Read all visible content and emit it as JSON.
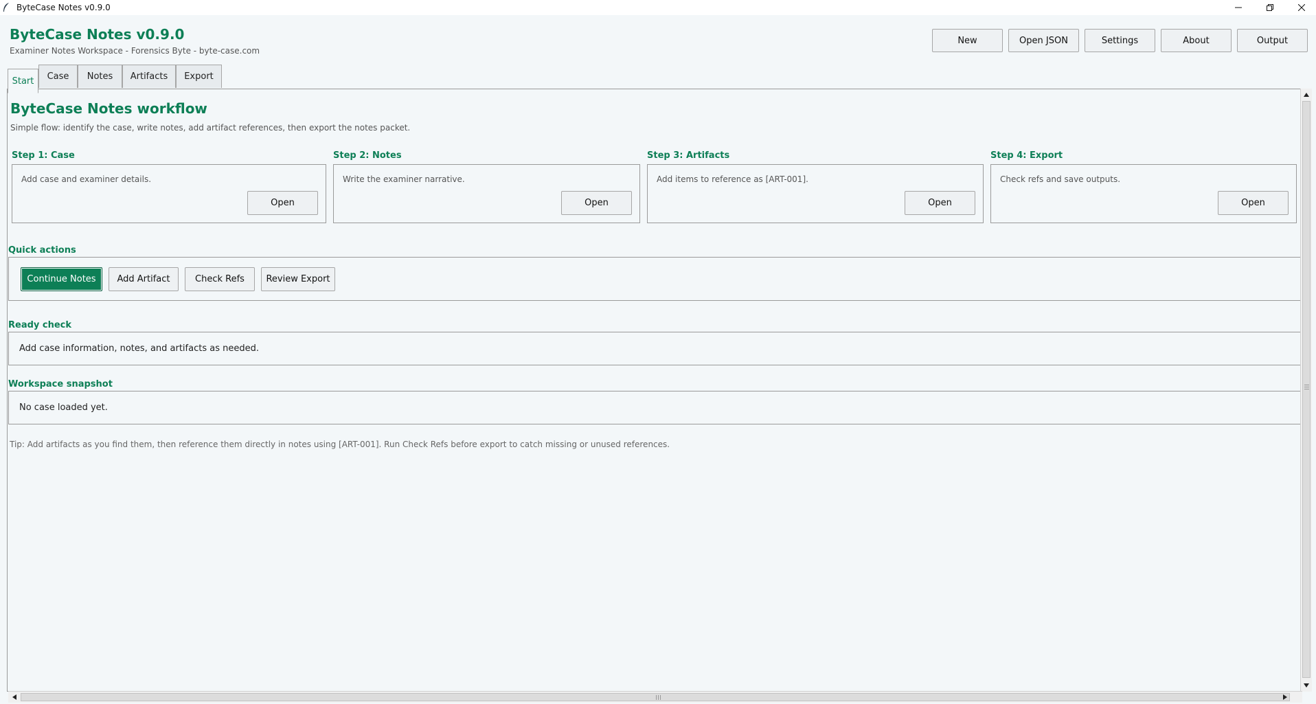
{
  "window": {
    "title": "ByteCase Notes v0.9.0",
    "icon": "feather-icon",
    "controls": [
      "minimize-icon",
      "restore-icon",
      "close-icon"
    ]
  },
  "header": {
    "title": "ByteCase Notes v0.9.0",
    "subtitle": "Examiner Notes Workspace - Forensics Byte - byte-case.com",
    "buttons": [
      "New",
      "Open JSON",
      "Settings",
      "About",
      "Output"
    ]
  },
  "tabs": [
    {
      "label": "Start",
      "active": true
    },
    {
      "label": "Case",
      "active": false
    },
    {
      "label": "Notes",
      "active": false
    },
    {
      "label": "Artifacts",
      "active": false
    },
    {
      "label": "Export",
      "active": false
    }
  ],
  "start": {
    "title": "ByteCase Notes workflow",
    "description": "Simple flow: identify the case, write notes, add artifact references, then export the notes packet.",
    "steps": [
      {
        "label": "Step 1: Case",
        "text": "Add case and examiner details.",
        "button": "Open"
      },
      {
        "label": "Step 2: Notes",
        "text": "Write the examiner narrative.",
        "button": "Open"
      },
      {
        "label": "Step 3: Artifacts",
        "text": "Add items to reference as [ART-001].",
        "button": "Open"
      },
      {
        "label": "Step 4: Export",
        "text": "Check refs and save outputs.",
        "button": "Open"
      }
    ],
    "quick_actions": {
      "label": "Quick actions",
      "buttons": [
        "Continue Notes",
        "Add Artifact",
        "Check Refs",
        "Review Export"
      ]
    },
    "ready_check": {
      "label": "Ready check",
      "text": "Add case information, notes, and artifacts as needed."
    },
    "snapshot": {
      "label": "Workspace snapshot",
      "text": "No case loaded yet."
    },
    "tip": "Tip: Add artifacts as you find them, then reference them directly in notes using [ART-001]. Run Check Refs before export to catch missing or unused references."
  },
  "colors": {
    "accent": "#0d7f56",
    "background": "#f3f7f9",
    "border": "#9a9a9a"
  }
}
